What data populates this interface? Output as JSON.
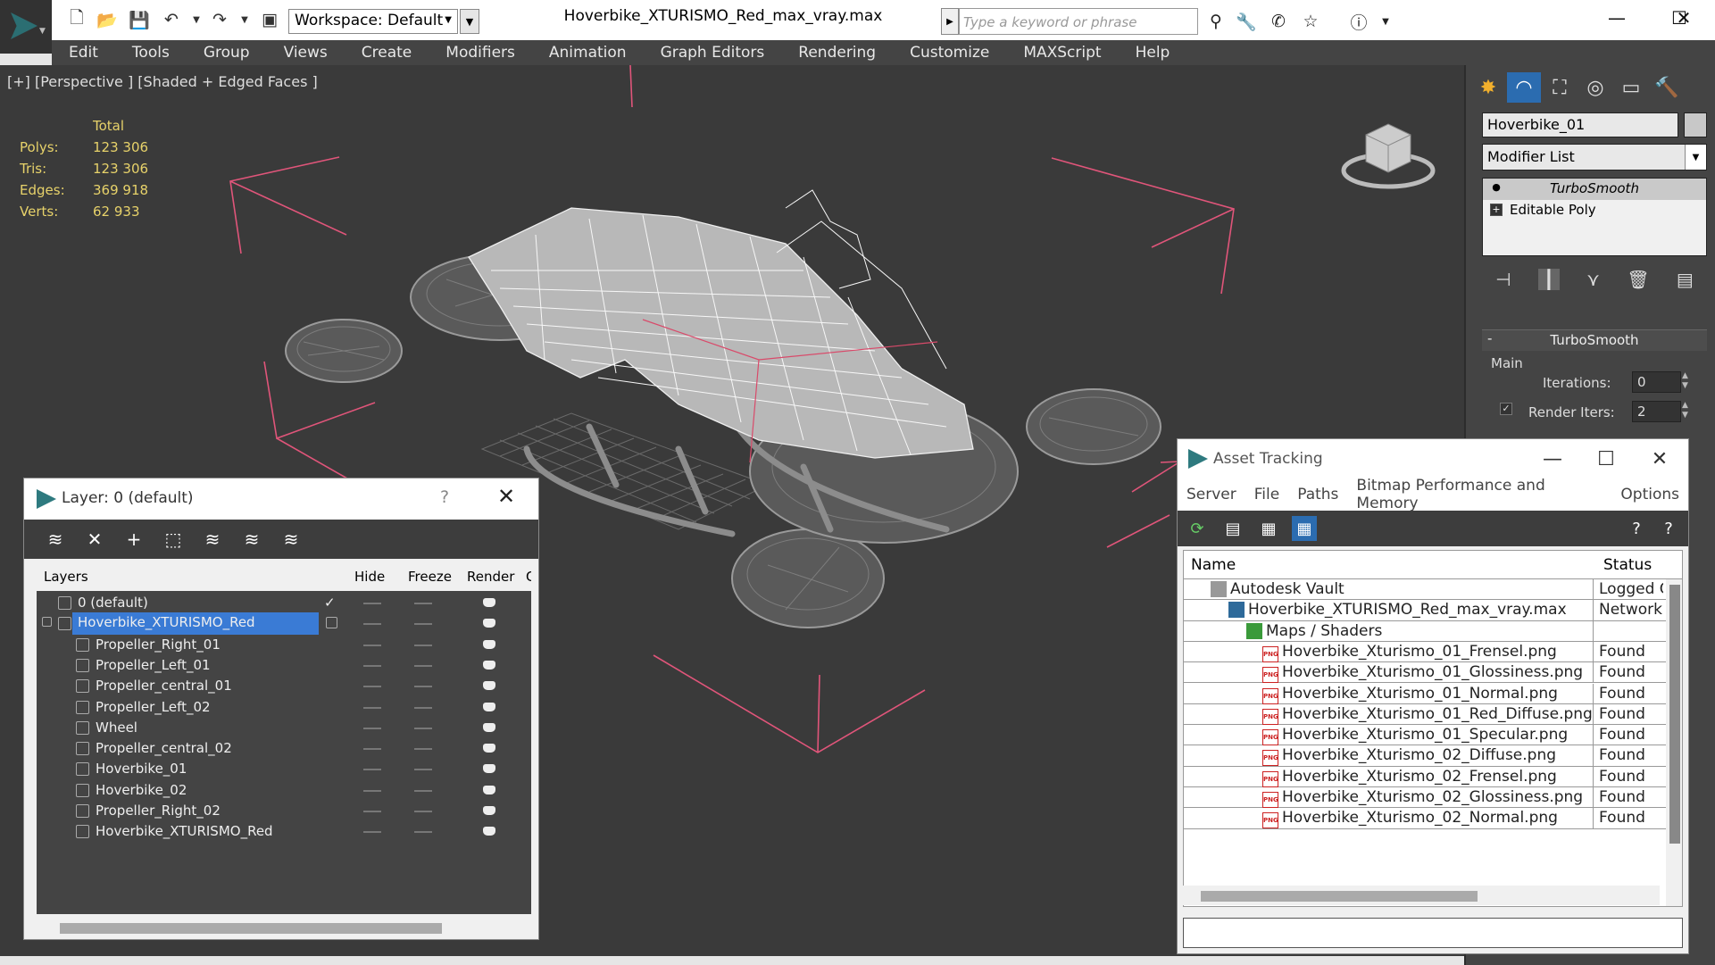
{
  "titlebar": {
    "workspace": "Workspace: Default",
    "document_title": "Hoverbike_XTURISMO_Red_max_vray.max",
    "search_placeholder": "Type a keyword or phrase"
  },
  "menu": [
    "Edit",
    "Tools",
    "Group",
    "Views",
    "Create",
    "Modifiers",
    "Animation",
    "Graph Editors",
    "Rendering",
    "Customize",
    "MAXScript",
    "Help"
  ],
  "viewport": {
    "label": "[+] [Perspective ] [Shaded + Edged Faces ]",
    "stats_header": "Total",
    "stats": [
      {
        "label": "Polys:",
        "value": "123 306"
      },
      {
        "label": "Tris:",
        "value": "123 306"
      },
      {
        "label": "Edges:",
        "value": "369 918"
      },
      {
        "label": "Verts:",
        "value": "62 933"
      }
    ]
  },
  "command_panel": {
    "object_name": "Hoverbike_01",
    "modifier_list": "Modifier List",
    "stack": [
      "TurboSmooth",
      "Editable Poly"
    ],
    "rollout_title": "TurboSmooth",
    "main_group": "Main",
    "iterations_label": "Iterations:",
    "iterations_value": "0",
    "render_iters_label": "Render Iters:",
    "render_iters_value": "2"
  },
  "layer_dialog": {
    "title": "Layer: 0 (default)",
    "help": "?",
    "columns": {
      "layers": "Layers",
      "hide": "Hide",
      "freeze": "Freeze",
      "render": "Render",
      "extra": "C"
    },
    "rows": [
      {
        "name": "0 (default)",
        "type": "layer"
      },
      {
        "name": "Hoverbike_XTURISMO_Red",
        "type": "layer",
        "selected": true
      },
      {
        "name": "Propeller_Right_01",
        "type": "object"
      },
      {
        "name": "Propeller_Left_01",
        "type": "object"
      },
      {
        "name": "Propeller_central_01",
        "type": "object"
      },
      {
        "name": "Propeller_Left_02",
        "type": "object"
      },
      {
        "name": "Wheel",
        "type": "object"
      },
      {
        "name": "Propeller_central_02",
        "type": "object"
      },
      {
        "name": "Hoverbike_01",
        "type": "object"
      },
      {
        "name": "Hoverbike_02",
        "type": "object"
      },
      {
        "name": "Propeller_Right_02",
        "type": "object"
      },
      {
        "name": "Hoverbike_XTURISMO_Red",
        "type": "object"
      }
    ]
  },
  "asset_dialog": {
    "title": "Asset Tracking",
    "menu": [
      "Server",
      "File",
      "Paths",
      "Bitmap Performance and Memory",
      "Options"
    ],
    "columns": {
      "name": "Name",
      "status": "Status"
    },
    "rows": [
      {
        "name": "Autodesk Vault",
        "status": "Logged O",
        "level": 1,
        "icon": "vault"
      },
      {
        "name": "Hoverbike_XTURISMO_Red_max_vray.max",
        "status": "Network",
        "level": 2,
        "icon": "max"
      },
      {
        "name": "Maps / Shaders",
        "status": "",
        "level": 3,
        "icon": "maps"
      },
      {
        "name": "Hoverbike_Xturismo_01_Frensel.png",
        "status": "Found",
        "level": 4,
        "icon": "png"
      },
      {
        "name": "Hoverbike_Xturismo_01_Glossiness.png",
        "status": "Found",
        "level": 4,
        "icon": "png"
      },
      {
        "name": "Hoverbike_Xturismo_01_Normal.png",
        "status": "Found",
        "level": 4,
        "icon": "png"
      },
      {
        "name": "Hoverbike_Xturismo_01_Red_Diffuse.png",
        "status": "Found",
        "level": 4,
        "icon": "png"
      },
      {
        "name": "Hoverbike_Xturismo_01_Specular.png",
        "status": "Found",
        "level": 4,
        "icon": "png"
      },
      {
        "name": "Hoverbike_Xturismo_02_Diffuse.png",
        "status": "Found",
        "level": 4,
        "icon": "png"
      },
      {
        "name": "Hoverbike_Xturismo_02_Frensel.png",
        "status": "Found",
        "level": 4,
        "icon": "png"
      },
      {
        "name": "Hoverbike_Xturismo_02_Glossiness.png",
        "status": "Found",
        "level": 4,
        "icon": "png"
      },
      {
        "name": "Hoverbike_Xturismo_02_Normal.png",
        "status": "Found",
        "level": 4,
        "icon": "png"
      }
    ],
    "icon_label": "PNG"
  },
  "colors": {
    "viewport_bg": "#3a3a3a",
    "stats_text": "#e7d26a",
    "bbox_bracket": "#e0557a",
    "selection": "#3a7bd5",
    "menubar_bg": "#444444"
  }
}
